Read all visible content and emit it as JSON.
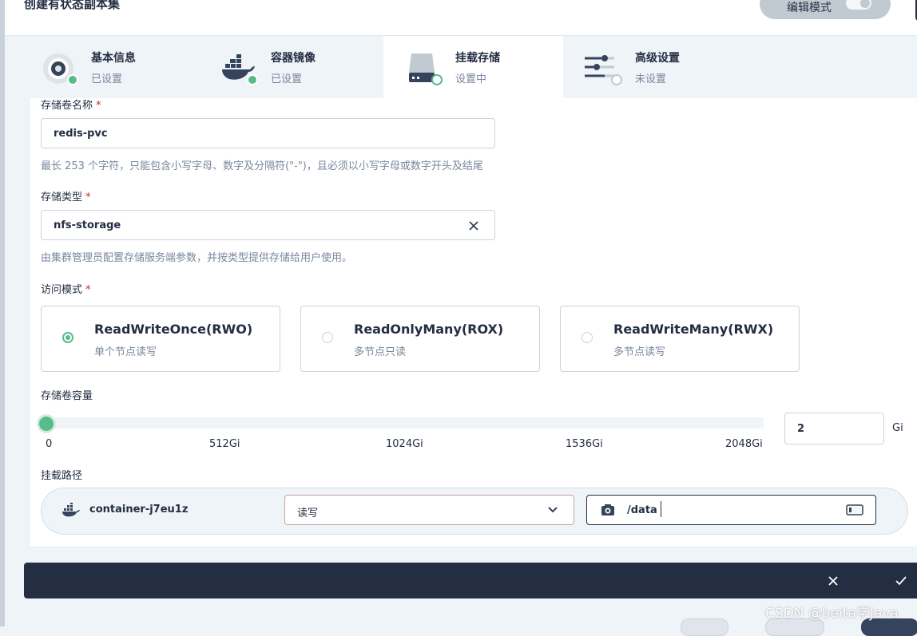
{
  "header": {
    "title": "创建有状态副本集",
    "edit_mode_label": "编辑模式"
  },
  "steps": [
    {
      "name": "基本信息",
      "state": "已设置",
      "icon": "disk-icon",
      "status": "done"
    },
    {
      "name": "容器镜像",
      "state": "已设置",
      "icon": "docker-icon",
      "status": "done"
    },
    {
      "name": "挂载存储",
      "state": "设置中",
      "icon": "storage-icon",
      "status": "in-progress"
    },
    {
      "name": "高级设置",
      "state": "未设置",
      "icon": "sliders-icon",
      "status": "todo"
    }
  ],
  "form": {
    "pvc_name": {
      "label": "存储卷名称",
      "required_mark": "*",
      "value": "redis-pvc",
      "hint": "最长 253 个字符，只能包含小写字母、数字及分隔符(\"-\")，且必须以小写字母或数字开头及结尾"
    },
    "storage_class": {
      "label": "存储类型",
      "required_mark": "*",
      "value": "nfs-storage",
      "hint": "由集群管理员配置存储服务端参数，并按类型提供存储给用户使用。"
    },
    "access_mode": {
      "label": "访问模式",
      "required_mark": "*",
      "options": [
        {
          "title": "ReadWriteOnce(RWO)",
          "desc": "单个节点读写",
          "selected": true
        },
        {
          "title": "ReadOnlyMany(ROX)",
          "desc": "多节点只读",
          "selected": false
        },
        {
          "title": "ReadWriteMany(RWX)",
          "desc": "多节点读写",
          "selected": false
        }
      ]
    },
    "capacity": {
      "label": "存储卷容量",
      "ticks": [
        "0",
        "512Gi",
        "1024Gi",
        "1536Gi",
        "2048Gi"
      ],
      "value": "2",
      "unit": "Gi",
      "slider_max_gi": 2048
    },
    "mount_path": {
      "label": "挂载路径",
      "container": "container-j7eu1z",
      "access": "读写",
      "path": "/data"
    }
  },
  "watermark": "CSDN @beita学Java",
  "colors": {
    "accent": "#55bc8a",
    "dark": "#242e42",
    "required": "#ca2621",
    "muted": "#79879c"
  }
}
